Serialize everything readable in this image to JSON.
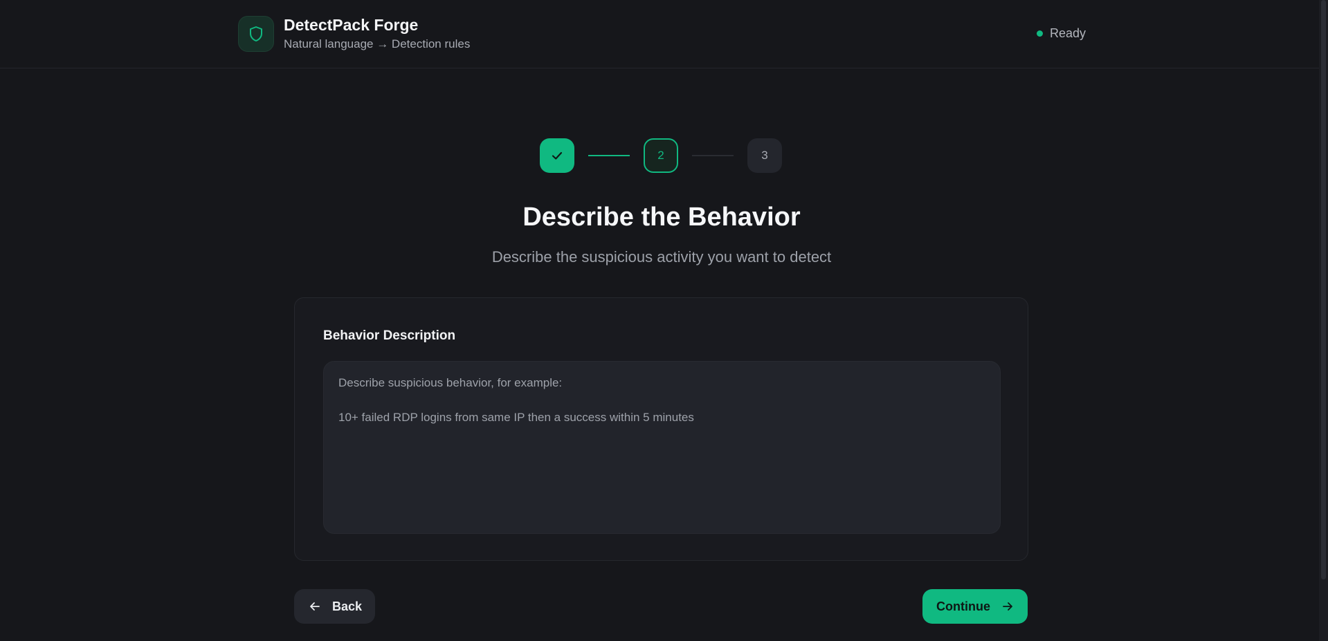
{
  "app": {
    "title": "DetectPack Forge",
    "subtitle": "Natural language → Detection rules",
    "logo_icon": "shield-icon"
  },
  "status": {
    "label": "Ready",
    "color": "#10b981"
  },
  "stepper": {
    "steps": [
      {
        "state": "complete",
        "icon": "check-icon"
      },
      {
        "state": "active",
        "label": "2"
      },
      {
        "state": "pending",
        "label": "3"
      }
    ]
  },
  "page": {
    "title": "Describe the Behavior",
    "subtitle": "Describe the suspicious activity you want to detect"
  },
  "form": {
    "label": "Behavior Description",
    "placeholder": "Describe suspicious behavior, for example:\n\n10+ failed RDP logins from same IP then a success within 5 minutes",
    "value": ""
  },
  "actions": {
    "back_label": "Back",
    "back_icon": "arrow-left-icon",
    "continue_label": "Continue",
    "continue_icon": "arrow-right-icon"
  },
  "colors": {
    "accent": "#10b981",
    "background": "#16171b"
  }
}
